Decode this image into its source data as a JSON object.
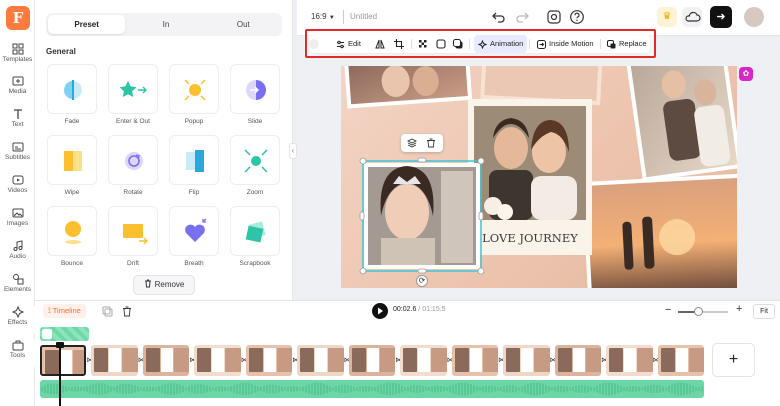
{
  "app": {
    "logo_letter": "F"
  },
  "rail": [
    {
      "name": "templates",
      "label": "Templates"
    },
    {
      "name": "media",
      "label": "Media"
    },
    {
      "name": "text",
      "label": "Text"
    },
    {
      "name": "subtitles",
      "label": "Subtitles"
    },
    {
      "name": "videos",
      "label": "Videos"
    },
    {
      "name": "images",
      "label": "Images"
    },
    {
      "name": "audio",
      "label": "Audio"
    },
    {
      "name": "elements",
      "label": "Elements"
    },
    {
      "name": "effects",
      "label": "Effects"
    },
    {
      "name": "tools",
      "label": "Tools"
    }
  ],
  "panel": {
    "tabs": [
      {
        "label": "Preset"
      },
      {
        "label": "In"
      },
      {
        "label": "Out"
      }
    ],
    "active_tab": "Preset",
    "section": "General",
    "effects": [
      {
        "label": "Fade",
        "icon": "fade-icon"
      },
      {
        "label": "Enter & Out",
        "icon": "star-arrow-icon"
      },
      {
        "label": "Popup",
        "icon": "popup-icon"
      },
      {
        "label": "Slide",
        "icon": "slide-icon"
      },
      {
        "label": "Wipe",
        "icon": "wipe-icon"
      },
      {
        "label": "Rotate",
        "icon": "rotate-icon"
      },
      {
        "label": "Flip",
        "icon": "flip-icon"
      },
      {
        "label": "Zoom",
        "icon": "zoom-icon"
      },
      {
        "label": "Bounce",
        "icon": "bounce-icon"
      },
      {
        "label": "Drift",
        "icon": "drift-icon"
      },
      {
        "label": "Breath",
        "icon": "heart-icon"
      },
      {
        "label": "Scrapbook",
        "icon": "scrapbook-icon"
      }
    ],
    "remove_label": "Remove"
  },
  "header": {
    "ratio": "16:9",
    "title": "Untitled",
    "export_icon": "arrow-right-icon"
  },
  "toolbar": {
    "edit": "Edit",
    "animation": "Animation",
    "inside_motion": "Inside Motion",
    "replace": "Replace"
  },
  "canvas": {
    "caption": "LOVE JOURNEY"
  },
  "playback": {
    "timeline_label": "Timeline",
    "current_time": "00:02.6",
    "total_time": " / 01:15.5",
    "zoom_level": 0.4,
    "fit_label": "Fit"
  },
  "timeline": {
    "clip_count": 13,
    "selected_clip": 1
  },
  "colors": {
    "accent": "#ff6b2c",
    "highlight_box": "#e02b2b",
    "audio": "#6dd6a7",
    "selection": "#3ec6d8"
  }
}
